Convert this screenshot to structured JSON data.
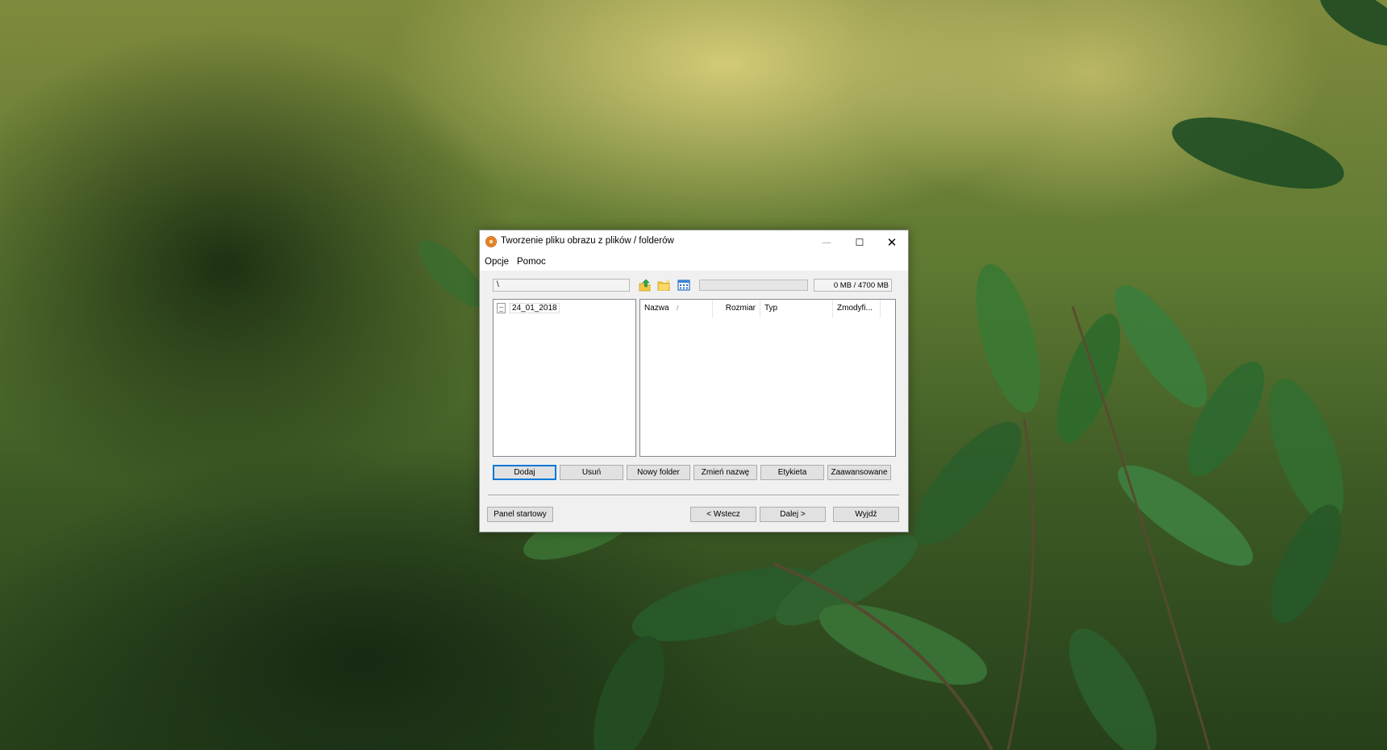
{
  "window": {
    "title": "Tworzenie pliku obrazu z plików / folderów",
    "controls": {
      "minimize": "—",
      "maximize": "☐",
      "close": "✕"
    }
  },
  "menu": {
    "items": [
      "Opcje",
      "Pomoc"
    ]
  },
  "toolbar": {
    "path": "\\",
    "capacity_text": "0 MB / 4700 MB",
    "capacity_fraction": 0.0,
    "icons": [
      "folder-up-icon",
      "new-folder-icon",
      "view-details-icon"
    ]
  },
  "tree": {
    "items": [
      {
        "label": "24_01_2018",
        "icon": "file-icon"
      }
    ]
  },
  "list": {
    "columns": [
      "Nazwa",
      "Rozmiar",
      "Typ",
      "Zmodyfi..."
    ],
    "sort_indicator": "/",
    "rows": []
  },
  "actions": {
    "add": "Dodaj",
    "remove": "Usuń",
    "new_folder": "Nowy folder",
    "rename": "Zmień nazwę",
    "label": "Etykieta",
    "advanced": "Zaawansowane"
  },
  "footer": {
    "start_panel": "Panel startowy",
    "back": "< Wstecz",
    "next": "Dalej >",
    "exit": "Wyjdź"
  },
  "colors": {
    "window_bg": "#f0f0f0",
    "focus_border": "#0078d7",
    "progress_fill": "#06b025"
  }
}
